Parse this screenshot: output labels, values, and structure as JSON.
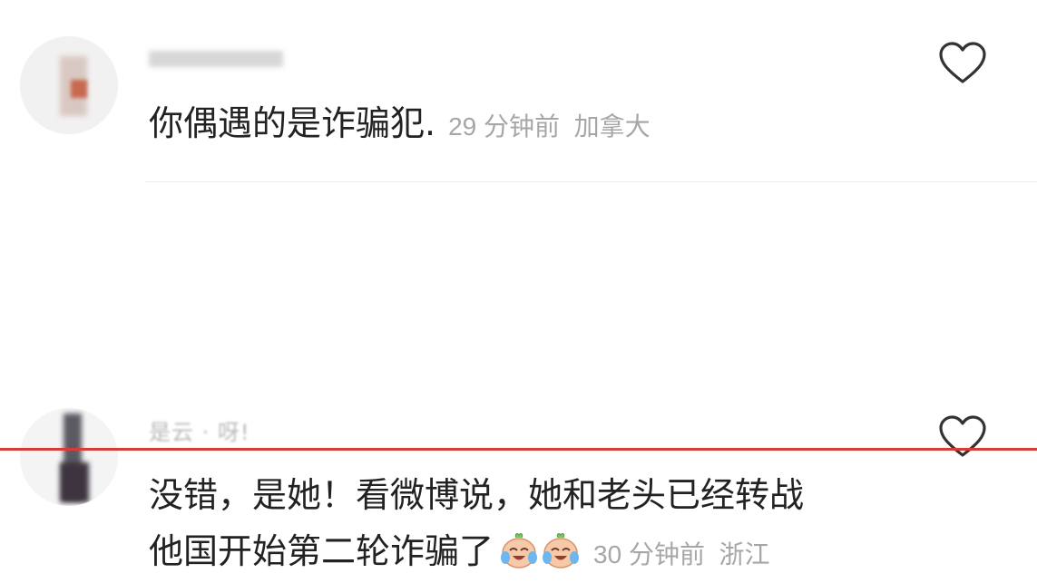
{
  "comments": [
    {
      "username": "",
      "text": "你偶遇的是诈骗犯.",
      "time": "29 分钟前",
      "location": "加拿大"
    },
    {
      "username": "是云  ·  呀!",
      "line1": "没错，是她！看微博说，她和老头已经转战",
      "line2": "他国开始第二轮诈骗了",
      "emoji": [
        "crying-laughing-face-emoji",
        "crying-laughing-face-emoji"
      ],
      "time": "30 分钟前",
      "location": "浙江"
    }
  ],
  "icons": {
    "like": "heart-outline-icon"
  },
  "colors": {
    "text": "#222222",
    "meta": "#a6a6a6",
    "accent": "#d93a3a"
  }
}
